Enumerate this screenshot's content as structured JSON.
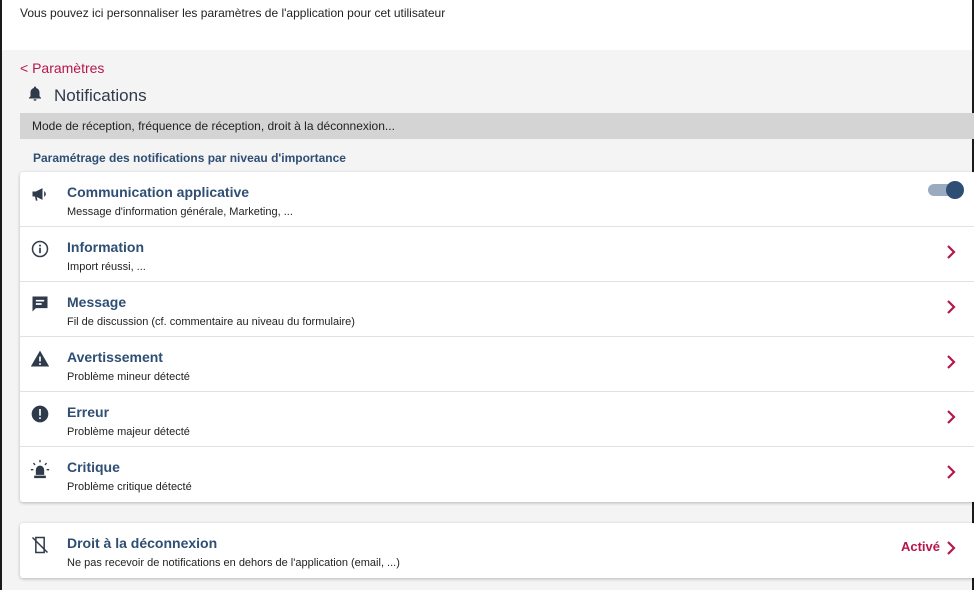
{
  "intro_text": "Vous pouvez ici personnaliser les paramètres de l'application pour cet utilisateur",
  "back_link": "< Paramètres",
  "page_title": "Notifications",
  "page_title_icon": "bell-icon",
  "subtitle": "Mode de réception, fréquence de réception, droit à la déconnexion...",
  "section_label": "Paramétrage des notifications par niveau d'importance",
  "colors": {
    "accent": "#b5174d",
    "title_blue": "#2f4e73",
    "toggle_track": "#9aaabf"
  },
  "levels": [
    {
      "icon": "megaphone-icon",
      "title": "Communication applicative",
      "desc": "Message d'information générale, Marketing, ...",
      "control": "toggle",
      "enabled": true
    },
    {
      "icon": "info-icon",
      "title": "Information",
      "desc": "Import réussi, ...",
      "control": "chevron"
    },
    {
      "icon": "message-icon",
      "title": "Message",
      "desc": "Fil de discussion (cf. commentaire au niveau du formulaire)",
      "control": "chevron"
    },
    {
      "icon": "warning-icon",
      "title": "Avertissement",
      "desc": "Problème mineur détecté",
      "control": "chevron"
    },
    {
      "icon": "error-icon",
      "title": "Erreur",
      "desc": "Problème majeur détecté",
      "control": "chevron"
    },
    {
      "icon": "siren-icon",
      "title": "Critique",
      "desc": "Problème critique détecté",
      "control": "chevron"
    }
  ],
  "disconnect": {
    "icon": "phone-off-icon",
    "title": "Droit à la déconnexion",
    "desc": "Ne pas recevoir de notifications en dehors de l'application (email, ...)",
    "status": "Activé"
  }
}
